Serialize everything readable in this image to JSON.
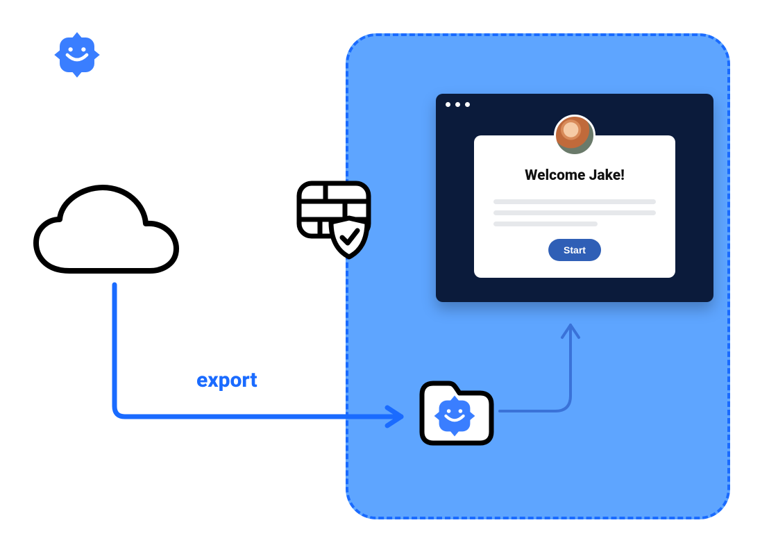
{
  "labels": {
    "export": "export"
  },
  "card": {
    "welcome": "Welcome Jake!",
    "button": "Start"
  },
  "colors": {
    "container_bg": "#5ea5ff",
    "container_border": "#1a6bff",
    "browser_bg": "#0b1b3b",
    "arrow_bold": "#1a6bff",
    "arrow_light": "#3a72d8",
    "button_bg": "#2f5fb6"
  }
}
